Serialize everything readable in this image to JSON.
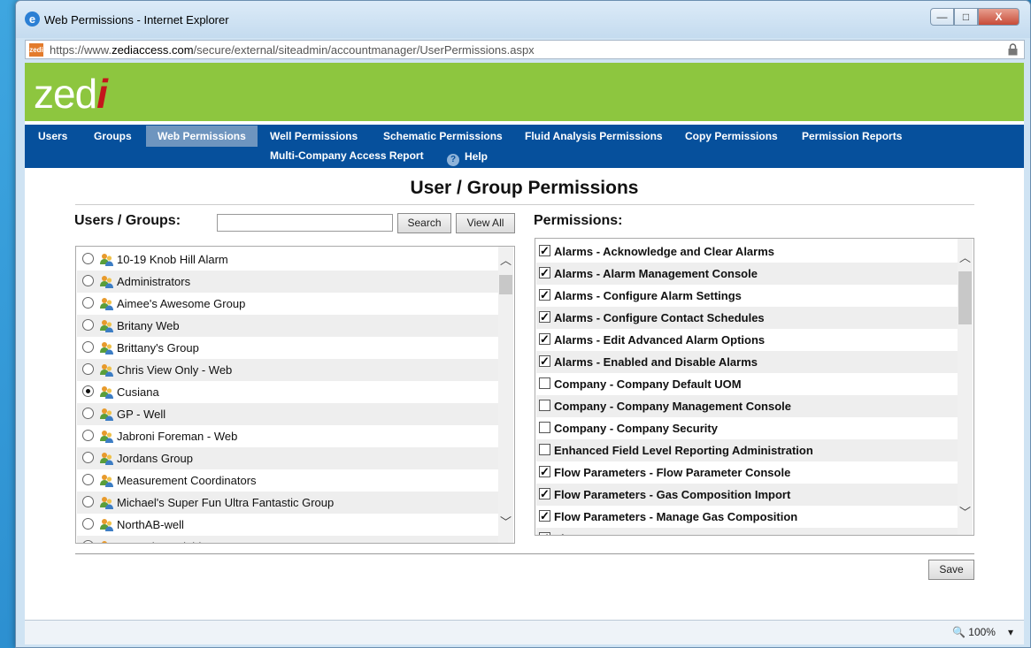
{
  "window": {
    "title": "Web Permissions - Internet Explorer",
    "buttons": [
      "—",
      "□",
      "X"
    ]
  },
  "address": {
    "favicon": "zedi",
    "url_prefix": "https://www.",
    "url_domain": "zediaccess.com",
    "url_path": "/secure/external/siteadmin/accountmanager/UserPermissions.aspx"
  },
  "brand": {
    "logo_text": "zed",
    "logo_accent": "i",
    "color": "#8dc63f"
  },
  "nav": {
    "items": [
      "Users",
      "Groups",
      "Web Permissions",
      "Well Permissions",
      "Schematic Permissions",
      "Fluid Analysis Permissions",
      "Copy Permissions",
      "Permission Reports"
    ],
    "row2": [
      "Multi-Company Access Report",
      "Help"
    ],
    "active": "Web Permissions",
    "color": "#06509c"
  },
  "page": {
    "title": "User / Group Permissions",
    "users_label": "Users / Groups:",
    "search_button": "Search",
    "viewall_button": "View All",
    "permissions_label": "Permissions:",
    "save_button": "Save"
  },
  "groups": [
    {
      "label": "10-19 Knob Hill Alarm",
      "selected": false
    },
    {
      "label": "Administrators",
      "selected": false
    },
    {
      "label": "Aimee's Awesome Group",
      "selected": false
    },
    {
      "label": "Britany Web",
      "selected": false
    },
    {
      "label": "Brittany's Group",
      "selected": false
    },
    {
      "label": "Chris View Only - Web",
      "selected": false
    },
    {
      "label": "Cusiana",
      "selected": true
    },
    {
      "label": "GP - Well",
      "selected": false
    },
    {
      "label": "Jabroni Foreman - Web",
      "selected": false
    },
    {
      "label": "Jordans Group",
      "selected": false
    },
    {
      "label": "Measurement Coordinators",
      "selected": false
    },
    {
      "label": "Michael's Super Fun Ultra Fantastic Group",
      "selected": false
    },
    {
      "label": "NorthAB-well",
      "selected": false
    },
    {
      "label": "Operations Field Access",
      "selected": false
    }
  ],
  "permissions": [
    {
      "label": "Alarms - Acknowledge and Clear Alarms",
      "checked": true
    },
    {
      "label": "Alarms - Alarm Management Console",
      "checked": true
    },
    {
      "label": "Alarms - Configure Alarm Settings",
      "checked": true
    },
    {
      "label": "Alarms - Configure Contact Schedules",
      "checked": true
    },
    {
      "label": "Alarms - Edit Advanced Alarm Options",
      "checked": true
    },
    {
      "label": "Alarms - Enabled and Disable Alarms",
      "checked": true
    },
    {
      "label": "Company - Company Default UOM",
      "checked": false
    },
    {
      "label": "Company - Company Management Console",
      "checked": false
    },
    {
      "label": "Company - Company Security",
      "checked": false
    },
    {
      "label": "Enhanced Field Level Reporting Administration",
      "checked": false
    },
    {
      "label": "Flow Parameters - Flow Parameter Console",
      "checked": true
    },
    {
      "label": "Flow Parameters - Gas Composition Import",
      "checked": true
    },
    {
      "label": "Flow Parameters - Manage Gas Composition",
      "checked": true
    },
    {
      "label": "Flow Parameters - Manage Meter Parameters",
      "checked": true
    }
  ],
  "status": {
    "zoom": "100%"
  }
}
